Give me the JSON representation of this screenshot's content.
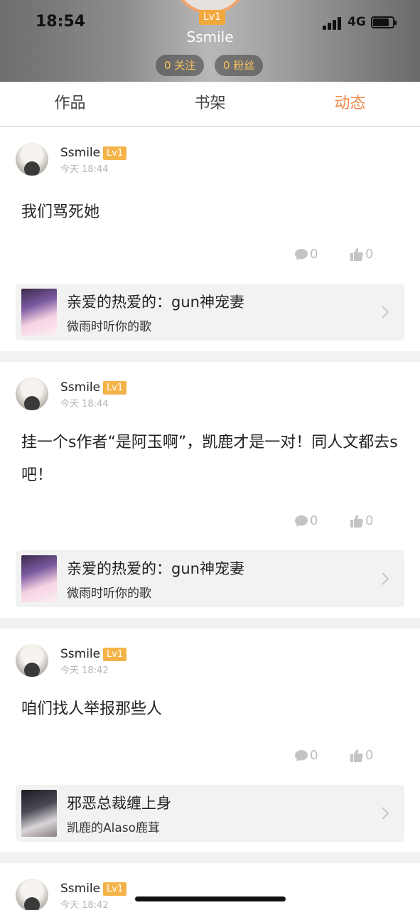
{
  "status_bar": {
    "time": "18:54",
    "network": "4G"
  },
  "profile": {
    "level": "Lv1",
    "name": "Ssmile",
    "follow": "0 关注",
    "fans": "0 粉丝"
  },
  "tabs": [
    {
      "label": "作品"
    },
    {
      "label": "书架"
    },
    {
      "label": "动态"
    }
  ],
  "active_tab": "动态",
  "colors": {
    "accent": "#f08a4b",
    "level_badge": "#f4b348"
  },
  "posts": [
    {
      "user": "Ssmile",
      "level": "Lv1",
      "time": "今天 18:44",
      "text": "我们骂死她",
      "comments": "0",
      "likes": "0",
      "book": {
        "title": "亲爱的热爱的：gun神宠妻",
        "author": "微雨时听你的歌"
      }
    },
    {
      "user": "Ssmile",
      "level": "Lv1",
      "time": "今天 18:44",
      "text": "挂一个s作者“是阿玉啊”，凯鹿才是一对！同人文都去s吧！",
      "comments": "0",
      "likes": "0",
      "book": {
        "title": "亲爱的热爱的：gun神宠妻",
        "author": "微雨时听你的歌"
      }
    },
    {
      "user": "Ssmile",
      "level": "Lv1",
      "time": "今天 18:42",
      "text": "咱们找人举报那些人",
      "comments": "0",
      "likes": "0",
      "book": {
        "title": "邪恶总裁缠上身",
        "author": "凯鹿的Alaso鹿茸"
      }
    },
    {
      "user": "Ssmile",
      "level": "Lv1",
      "time": "今天 18:42"
    }
  ]
}
